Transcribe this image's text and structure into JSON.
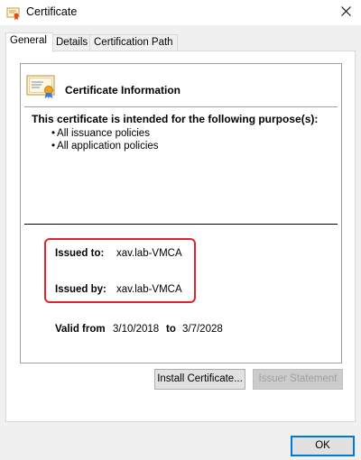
{
  "window": {
    "title": "Certificate",
    "close_glyph": "×"
  },
  "tabs": [
    {
      "label": "General",
      "active": true
    },
    {
      "label": "Details",
      "active": false
    },
    {
      "label": "Certification Path",
      "active": false
    }
  ],
  "cert": {
    "info_title": "Certificate Information",
    "purpose_heading": "This certificate is intended for the following purpose(s):",
    "purposes": [
      "All issuance policies",
      "All application policies"
    ],
    "issued_to_label": "Issued to:",
    "issued_to_value": "xav.lab-VMCA",
    "issued_by_label": "Issued by:",
    "issued_by_value": "xav.lab-VMCA",
    "valid_from_label": "Valid from",
    "valid_from_value": "3/10/2018",
    "valid_to_label": "to",
    "valid_to_value": "3/7/2028"
  },
  "buttons": {
    "install": "Install Certificate...",
    "issuer_statement": "Issuer Statement",
    "ok": "OK"
  },
  "colors": {
    "highlight": "#e0242b",
    "ok_border": "#0078d7"
  },
  "icons": {
    "title": "certificate-icon",
    "info": "certificate-icon",
    "close": "close-icon"
  }
}
